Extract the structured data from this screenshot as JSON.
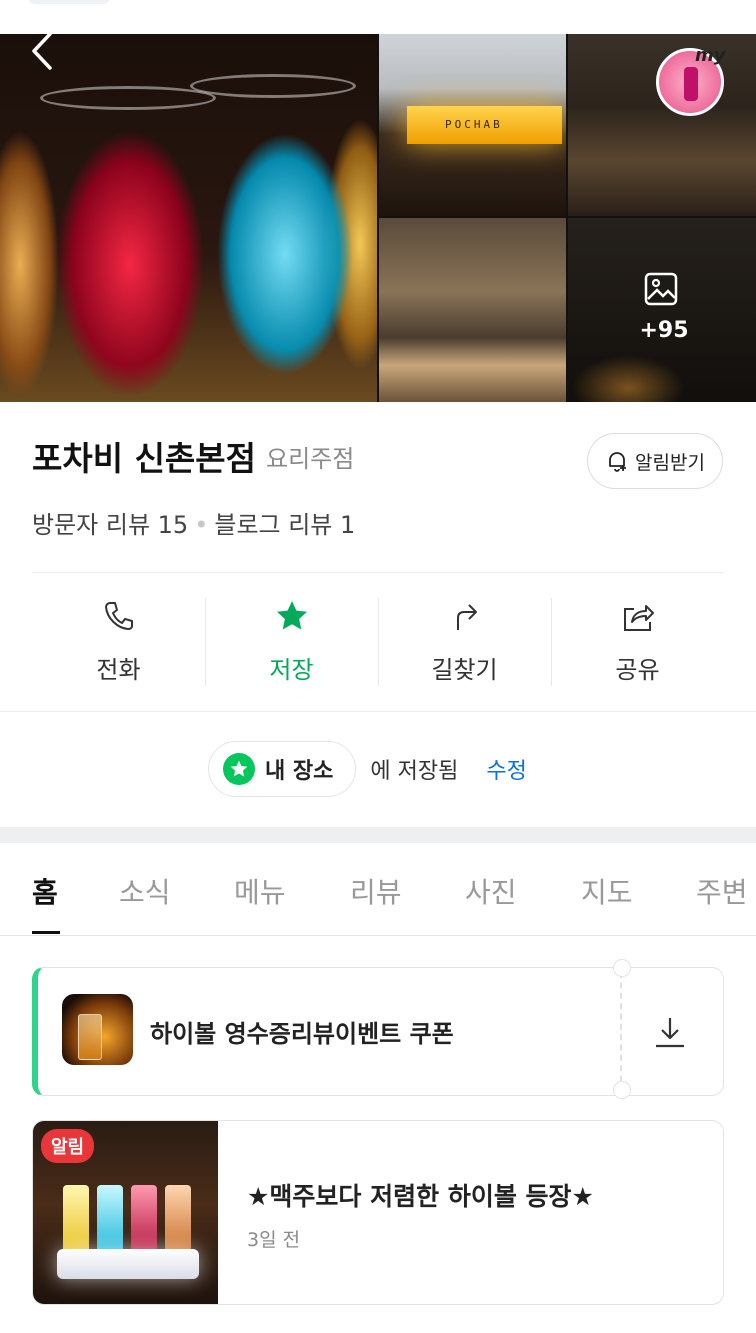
{
  "header": {
    "back_icon": "chevron-left-icon",
    "my_badge_label": "my",
    "more_photos_count": "+95",
    "photo_sign_text": "POCHAB"
  },
  "place": {
    "name": "포차비 신촌본점",
    "category": "요리주점",
    "alarm_label": "알림받기",
    "visitor_reviews": "방문자 리뷰 15",
    "blog_reviews": "블로그 리뷰 1"
  },
  "actions": [
    {
      "label": "전화",
      "icon": "phone-icon"
    },
    {
      "label": "저장",
      "icon": "star-icon",
      "active": true
    },
    {
      "label": "길찾기",
      "icon": "directions-icon"
    },
    {
      "label": "공유",
      "icon": "share-icon"
    }
  ],
  "saved": {
    "list_name": "내 장소",
    "saved_text": "에 저장됨",
    "edit_label": "수정"
  },
  "tabs": [
    {
      "label": "홈",
      "active": true
    },
    {
      "label": "소식"
    },
    {
      "label": "메뉴"
    },
    {
      "label": "리뷰"
    },
    {
      "label": "사진"
    },
    {
      "label": "지도"
    },
    {
      "label": "주변"
    }
  ],
  "coupon": {
    "title": "하이볼 영수증리뷰이벤트 쿠폰"
  },
  "notice": {
    "badge": "알림",
    "title": "★맥주보다 저렴한 하이볼 등장★",
    "time": "3일 전"
  },
  "colors": {
    "accent_green": "#03c75a",
    "link_blue": "#0a6fd6",
    "badge_red": "#e8363a"
  }
}
